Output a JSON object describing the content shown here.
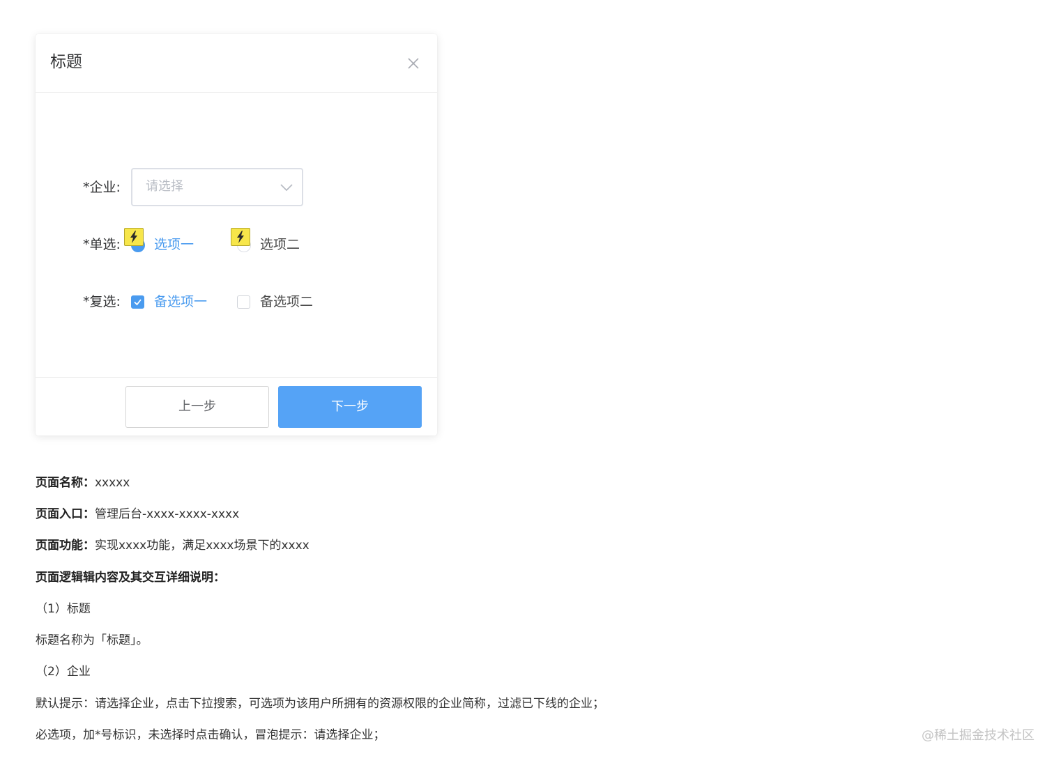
{
  "dialog": {
    "title": "标题",
    "form": {
      "enterprise": {
        "label": "*企业:",
        "placeholder": "请选择"
      },
      "radio": {
        "label": "*单选:",
        "options": [
          {
            "label": "选项一",
            "selected": true
          },
          {
            "label": "选项二",
            "selected": false
          }
        ]
      },
      "checkbox": {
        "label": "*复选:",
        "options": [
          {
            "label": "备选项一",
            "checked": true
          },
          {
            "label": "备选项二",
            "checked": false
          }
        ]
      }
    },
    "footer": {
      "prev_label": "上一步",
      "next_label": "下一步"
    }
  },
  "doc": {
    "page_name_key": "页面名称：",
    "page_name_value": "xxxxx",
    "page_entry_key": "页面入口：",
    "page_entry_value": "管理后台-xxxx-xxxx-xxxx",
    "page_function_key": "页面功能：",
    "page_function_value": "实现xxxx功能，满足xxxx场景下的xxxx",
    "logic_heading": "页面逻辑辑内容及其交互详细说明：",
    "section1_title": "（1）标题",
    "section1_body": "标题名称为「标题」。",
    "section2_title": "（2）企业",
    "section2_body1": "默认提示：请选择企业，点击下拉搜索，可选项为该用户所拥有的资源权限的企业简称，过滤已下线的企业；",
    "section2_body2": "必选项，加*号标识，未选择时点击确认，冒泡提示：请选择企业；"
  },
  "watermark": "@稀土掘金技术社区",
  "colors": {
    "primary": "#4a9bef",
    "button_primary": "#55a3f6",
    "flash_badge": "#f7e64a"
  }
}
